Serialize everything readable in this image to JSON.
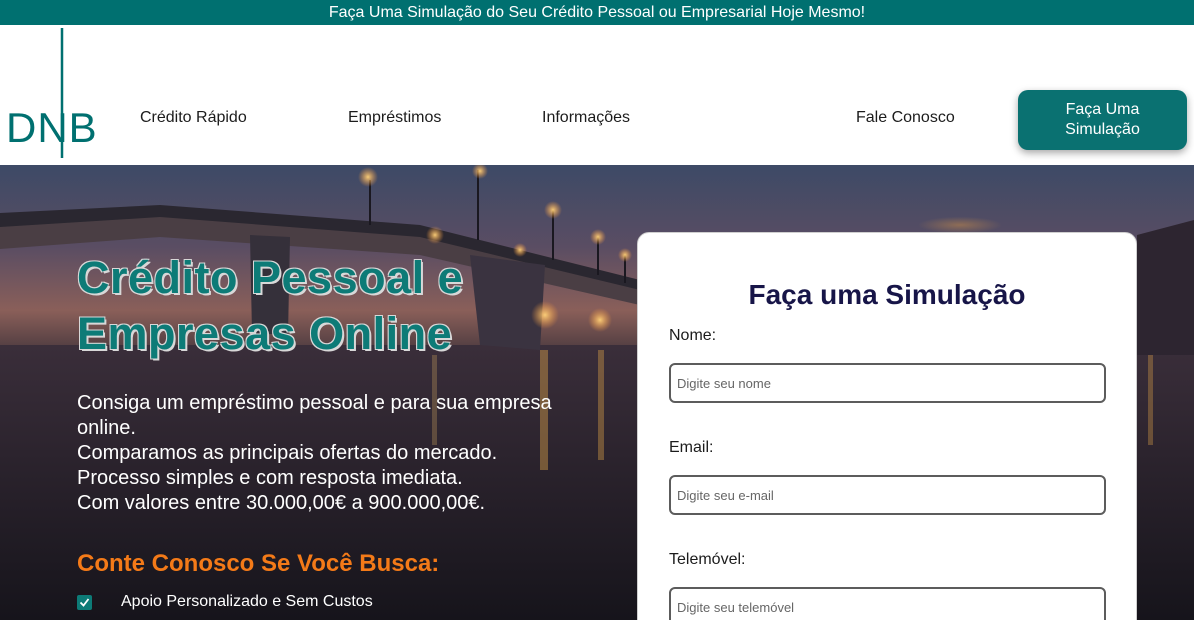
{
  "topbar": {
    "text": "Faça Uma Simulação do Seu Crédito Pessoal ou Empresarial Hoje Mesmo!"
  },
  "brand": {
    "logo_text": "DNB",
    "accent": "#007070"
  },
  "nav": {
    "items": [
      {
        "label": "Crédito Rápido"
      },
      {
        "label": "Empréstimos"
      },
      {
        "label": "Informações"
      },
      {
        "label": "Fale Conosco"
      }
    ],
    "cta_label": "Faça Uma Simulação"
  },
  "hero": {
    "title": "Crédito Pessoal e Empresas Online",
    "description": [
      "Consiga um empréstimo pessoal e para sua empresa online.",
      "Comparamos as principais ofertas do mercado.",
      "Processo simples e com resposta imediata.",
      "Com valores entre 30.000,00€ a 900.000,00€."
    ],
    "subtitle": "Conte Conosco Se Você Busca:",
    "checklist": [
      "Apoio Personalizado e Sem Custos"
    ],
    "title_color": "#0d7b77",
    "subtitle_color": "#f47a18"
  },
  "form": {
    "title": "Faça uma Simulação",
    "fields": [
      {
        "label": "Nome:",
        "placeholder": "Digite seu nome",
        "value": ""
      },
      {
        "label": "Email:",
        "placeholder": "Digite seu e-mail",
        "value": ""
      },
      {
        "label": "Telemóvel:",
        "placeholder": "Digite seu telemóvel",
        "value": ""
      }
    ],
    "title_color": "#171548"
  }
}
